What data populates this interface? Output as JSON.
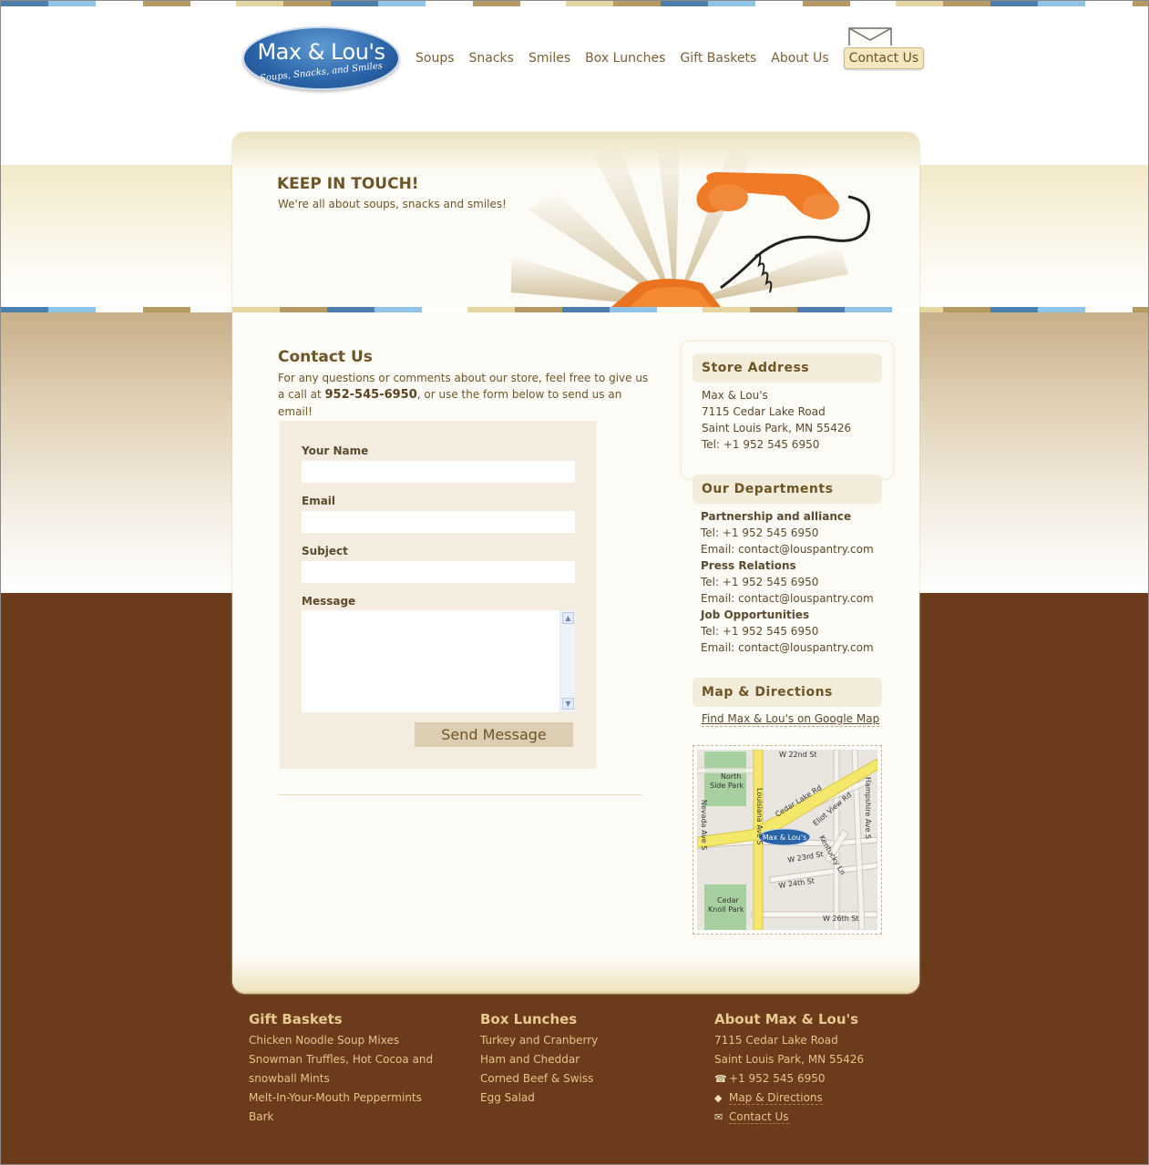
{
  "brand": {
    "name": "Max & Lou's",
    "tagline": "Soups, Snacks, and Smiles"
  },
  "nav": {
    "items": [
      "Soups",
      "Snacks",
      "Smiles",
      "Box Lunches",
      "Gift Baskets",
      "About Us"
    ],
    "active": "Contact Us"
  },
  "hero": {
    "title": "KEEP IN TOUCH!",
    "subtitle": "We're all about soups, snacks and smiles!"
  },
  "contact": {
    "title": "Contact Us",
    "intro_before": "For any questions or comments about our store, feel free to give us a call at",
    "phone": "952-545-6950",
    "intro_after": ", or use the form below to send us an email!"
  },
  "form": {
    "name_label": "Your Name",
    "email_label": "Email",
    "subject_label": "Subject",
    "message_label": "Message",
    "send_label": "Send Message"
  },
  "sidebar": {
    "store": {
      "heading": "Store Address",
      "lines": [
        "Max & Lou's",
        "7115 Cedar Lake Road",
        "Saint Louis Park, MN 55426",
        "Tel: +1 952 545 6950"
      ]
    },
    "departments": {
      "heading": "Our Departments",
      "items": [
        {
          "name": "Partnership and alliance",
          "tel": "Tel: +1 952 545 6950",
          "email": "Email: contact@louspantry.com"
        },
        {
          "name": "Press Relations",
          "tel": "Tel: +1 952 545 6950",
          "email": "Email: contact@louspantry.com"
        },
        {
          "name": "Job Opportunities",
          "tel": "Tel: +1 952 545 6950",
          "email": "Email: contact@louspantry.com"
        }
      ]
    },
    "map": {
      "heading": "Map & Directions",
      "link": "Find Max & Lou's on Google Map",
      "labels": {
        "w22": "W 22nd St",
        "north_park": "North",
        "north_park2": "Side Park",
        "cedar_lake": "Cedar Lake Rd",
        "elliot": "Eliot View Rd",
        "hampshire": "Hampshire Ave S",
        "nevada": "Nevada Ave S",
        "louisiana": "Louisiana Ave S",
        "kentucky": "Kentucky Ln",
        "w23": "W 23rd St",
        "w24": "W 24th St",
        "w26": "W 26th St",
        "cedar_knoll": "Cedar",
        "cedar_knoll2": "Knoll Park",
        "marker": "Max & Lou's"
      }
    }
  },
  "footer": {
    "gift": {
      "heading": "Gift Baskets",
      "items": [
        "Chicken Noodle Soup Mixes",
        "Snowman Truffles, Hot Cocoa and",
        "snowball Mints",
        "Melt-In-Your-Mouth Peppermints",
        "Bark"
      ]
    },
    "box": {
      "heading": "Box Lunches",
      "items": [
        "Turkey and Cranberry",
        "Ham and Cheddar",
        "Corned Beef & Swiss",
        "Egg Salad"
      ]
    },
    "about": {
      "heading": "About Max & Lou's",
      "address1": "7115 Cedar Lake Road",
      "address2": "Saint Louis Park, MN 55426",
      "phone": "+1 952 545 6950",
      "directions": "Map & Directions",
      "contact": "Contact Us"
    }
  },
  "colors": {
    "brown": "#6b3b1b",
    "cream": "#fdfbf5",
    "accent_text": "#6d5526",
    "footer_text": "#e4c48a",
    "logo_blue": "#2a64a8"
  }
}
